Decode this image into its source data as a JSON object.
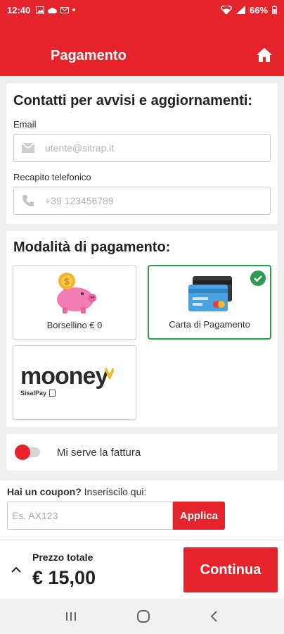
{
  "status_bar": {
    "time": "12:40",
    "battery": "66%"
  },
  "header": {
    "title": "Pagamento",
    "home_icon": "home-icon"
  },
  "contacts": {
    "heading": "Contatti per avvisi e aggiornamenti:",
    "email_label": "Email",
    "email_placeholder": "utente@sitrap.it",
    "phone_label": "Recapito telefonico",
    "phone_placeholder": "+39 123456789"
  },
  "payment": {
    "heading": "Modalità di pagamento:",
    "options": [
      {
        "label": "Borsellino € 0",
        "icon": "piggy-bank-icon",
        "selected": false
      },
      {
        "label": "Carta di Pagamento",
        "icon": "credit-card-icon",
        "selected": true
      },
      {
        "label": "",
        "icon": "mooney-logo",
        "selected": false
      }
    ]
  },
  "mooney_logo": {
    "brand": "mooney",
    "sub": "SisalPay"
  },
  "invoice": {
    "label": "Mi serve la fattura",
    "enabled": false
  },
  "coupon": {
    "question_bold": "Hai un coupon?",
    "question_rest": " Inseriscilo qui:",
    "placeholder": "Es. AX123",
    "apply_label": "Applica"
  },
  "footer": {
    "price_label": "Prezzo totale",
    "price_value": "€ 15,00",
    "continue_label": "Continua"
  },
  "colors": {
    "brand": "#e5232b",
    "selected": "#2e9a55"
  }
}
